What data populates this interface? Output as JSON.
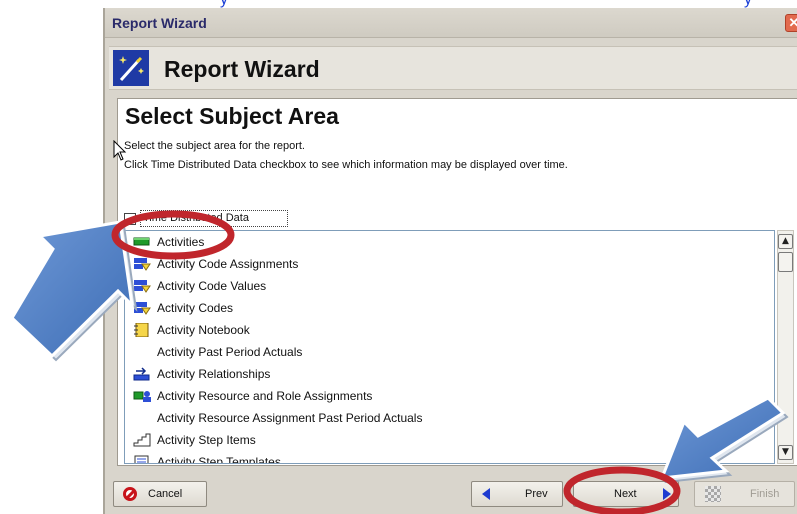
{
  "window": {
    "title": "Report Wizard",
    "close_glyph": "✕"
  },
  "header": {
    "title": "Report Wizard",
    "icon": "magic-wand-icon"
  },
  "section": {
    "title": "Select Subject Area",
    "instruction_1": "Select the subject area for the report.",
    "instruction_2": "Click Time Distributed Data checkbox to see which information may be displayed over time."
  },
  "time_distributed": {
    "label": "Time Distributed Data",
    "checked": false
  },
  "subject_list": {
    "items": [
      {
        "label": "Activities",
        "icon": "activities-icon",
        "selected": false
      },
      {
        "label": "Activity Code Assignments",
        "icon": "code-assignment-icon"
      },
      {
        "label": "Activity Code Values",
        "icon": "code-assignment-icon"
      },
      {
        "label": "Activity Codes",
        "icon": "code-assignment-icon"
      },
      {
        "label": "Activity Notebook",
        "icon": "notebook-icon"
      },
      {
        "label": "Activity Past Period Actuals",
        "icon": ""
      },
      {
        "label": "Activity Relationships",
        "icon": "relationship-icon"
      },
      {
        "label": "Activity Resource and Role Assignments",
        "icon": "resource-assignment-icon"
      },
      {
        "label": "Activity Resource Assignment Past Period Actuals",
        "icon": ""
      },
      {
        "label": "Activity Step Items",
        "icon": "step-items-icon"
      },
      {
        "label": "Activity Step Templates",
        "icon": "step-template-icon"
      }
    ]
  },
  "footer": {
    "cancel_label": "Cancel",
    "prev_label": "Prev",
    "next_label": "Next",
    "finish_label": "Finish"
  },
  "colors": {
    "annotation_red": "#c0262c",
    "annotation_arrow_blue": "#4c7cc0",
    "window_bg": "#d9d5cc"
  }
}
